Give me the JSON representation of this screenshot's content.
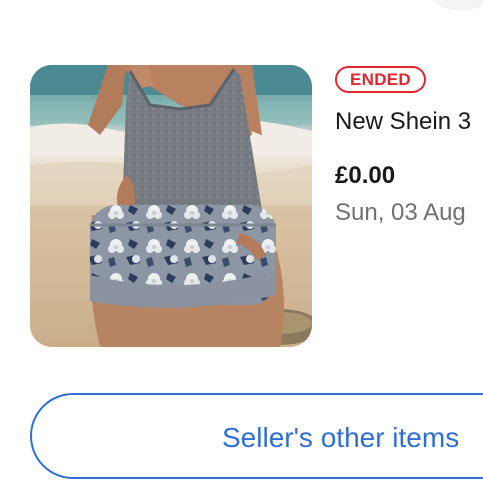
{
  "item": {
    "status_badge": "ENDED",
    "title": "New Shein 3",
    "price": "£0.00",
    "end_date": "Sun, 03 Aug",
    "image_alt": "Grey floral swimwear tankini photographed on a beach"
  },
  "actions": {
    "sellers_other_items_label": "Seller's other items"
  },
  "colors": {
    "ended_red": "#e0262f",
    "link_blue": "#2f6fd6",
    "title_text": "#191919",
    "muted_text": "#707070"
  }
}
